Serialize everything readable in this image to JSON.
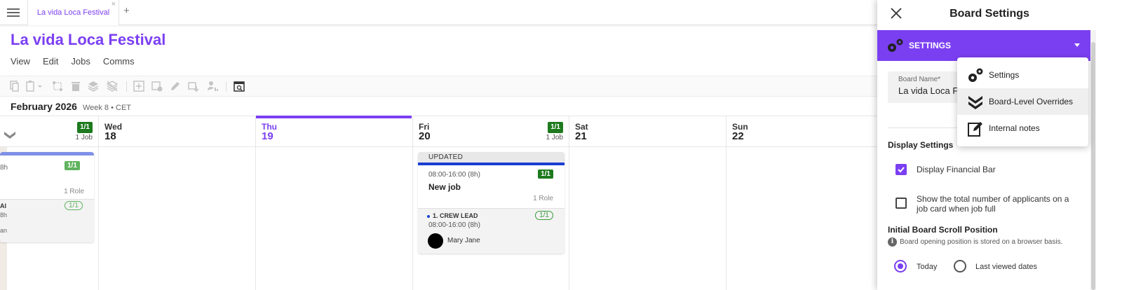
{
  "tabs": {
    "active_label": "La vida Loca Festival",
    "close_glyph": "×",
    "add_glyph": "+"
  },
  "board": {
    "title": "La vida Loca Festival",
    "menu": [
      "View",
      "Edit",
      "Jobs",
      "Comms"
    ]
  },
  "calendar": {
    "month": "February 2026",
    "week_info": "Week 8  • CET",
    "left_partial": {
      "badge": "1/1",
      "jobs": "1 Job",
      "card_badge": "1/1",
      "roles": "1 Role",
      "role_badge": "1/1",
      "frag1": "8h",
      "frag2": "Al",
      "frag3": "8h",
      "frag4": "an"
    },
    "days": [
      {
        "name": "Wed",
        "num": "18"
      },
      {
        "name": "Thu",
        "num": "19"
      },
      {
        "name": "Fri",
        "num": "20",
        "badge": "1/1",
        "jobs": "1 Job"
      },
      {
        "name": "Sat",
        "num": "21"
      },
      {
        "name": "Sun",
        "num": "22"
      }
    ],
    "job_card": {
      "status": "UPDATED",
      "time": "08:00-16:00 (8h)",
      "badge": "1/1",
      "title": "New job",
      "roles": "1 Role",
      "role": {
        "name": "1. CREW LEAD",
        "badge": "1/1",
        "time": "08:00-16:00 (8h)",
        "person": "Mary Jane"
      }
    }
  },
  "panel": {
    "title": "Board Settings",
    "section": "SETTINGS",
    "board_name_label": "Board Name*",
    "board_name_value": "La vida Loca Festival",
    "display_settings": "Display Settings",
    "checkbox1": "Display Financial Bar",
    "checkbox2": "Show the total number of applicants on a job card when job full",
    "scroll_heading": "Initial Board Scroll Position",
    "scroll_info": "Board opening position is stored on a browser basis.",
    "radio_today": "Today",
    "radio_last": "Last viewed dates"
  },
  "dropdown": {
    "items": [
      "Settings",
      "Board-Level Overrides",
      "Internal notes"
    ]
  },
  "colors": {
    "accent": "#7b3ff2",
    "green": "#1e7a1e",
    "blue_bar": "#1a3fd1"
  }
}
